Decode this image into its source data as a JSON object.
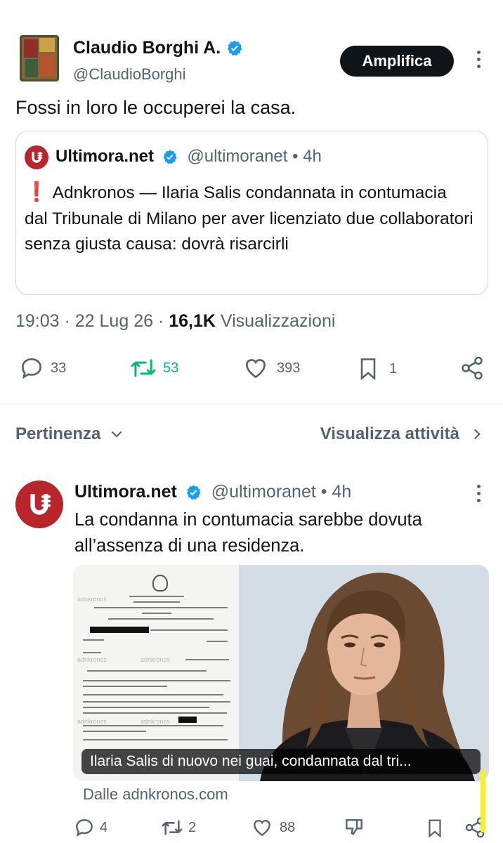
{
  "main_post": {
    "author_name": "Claudio Borghi A.",
    "handle": "@ClaudioBorghi",
    "action_button": "Amplifica",
    "text": "Fossi in loro le occuperei la casa.",
    "quote": {
      "author_name": "Ultimora.net",
      "handle_time": "@ultimoranet • 4h",
      "text": "Adnkronos — Ilaria Salis condannata in contumacia dal Tribunale di Milano per aver licenziato due collaboratori senza giusta causa: dovrà risarcirli"
    },
    "time": "19:03 · 22 Lug 26 · ",
    "views_count": "16,1K",
    "views_label": " Visualizzazioni",
    "stats": {
      "replies": "33",
      "reposts": "53",
      "likes": "393",
      "bookmarks": "1"
    }
  },
  "sort_bar": {
    "sort_label": "Pertinenza",
    "activity_link": "Visualizza attività"
  },
  "reply": {
    "author_name": "Ultimora.net",
    "handle_time": "@ultimoranet • 4h",
    "text": "La condanna in contumacia sarebbe dovuta all’assenza di una residenza.",
    "media_caption": "Ilaria Salis di nuovo nei guai, condannata dal tri...",
    "source": "Dalle adnkronos.com",
    "stats": {
      "replies": "4",
      "reposts": "2",
      "likes": "88"
    }
  },
  "colors": {
    "text_primary": "#0f1419",
    "text_secondary": "#536471",
    "verified_blue": "#1d9bf0",
    "repost_green": "#00ba7c",
    "brand_red": "#b8252a"
  },
  "icons": [
    "verified-badge-icon",
    "more-icon",
    "reply-icon",
    "repost-icon",
    "like-icon",
    "bookmark-icon",
    "share-icon",
    "chevron-down-icon",
    "chevron-right-icon",
    "dislike-icon"
  ]
}
